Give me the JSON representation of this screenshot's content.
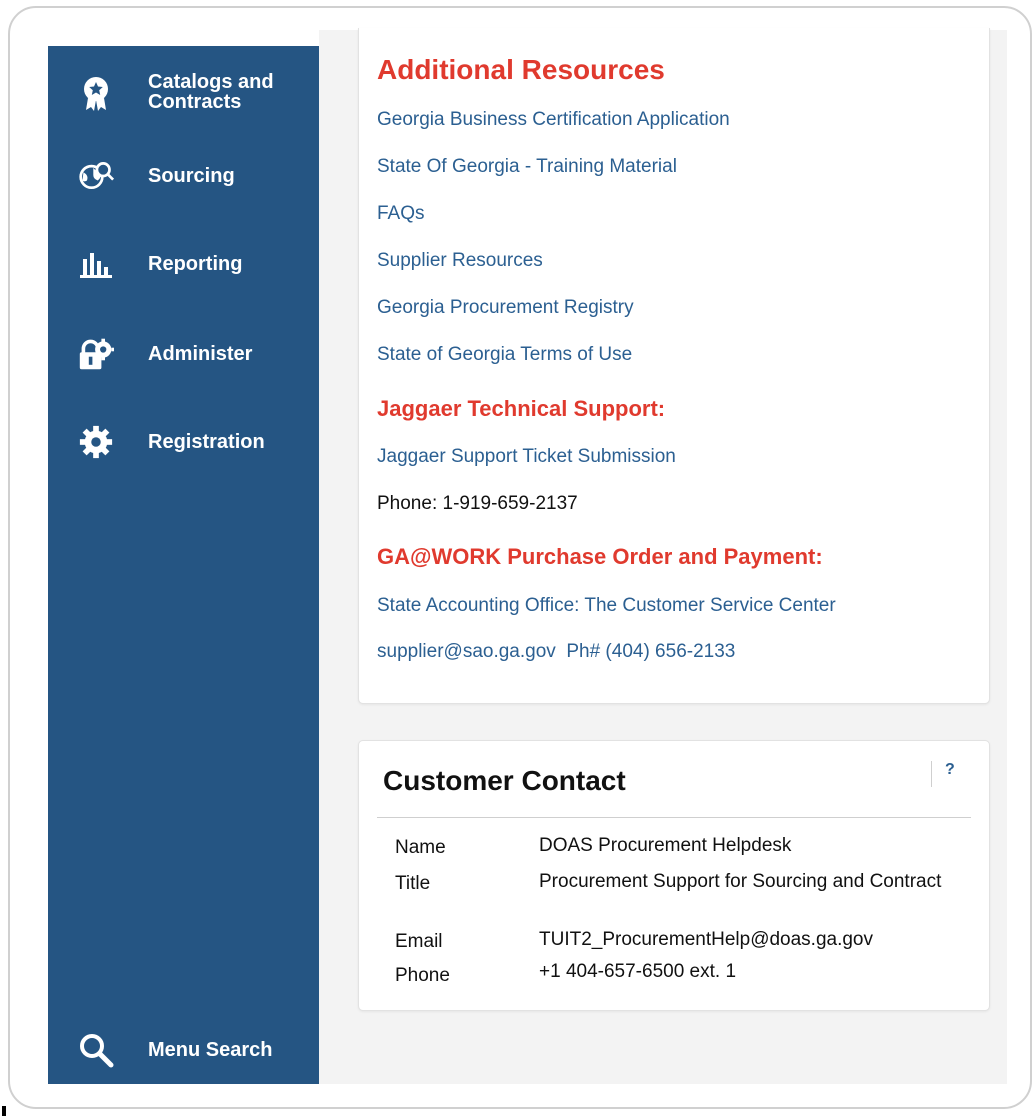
{
  "sidebar": {
    "items": [
      {
        "label": "Catalogs and Contracts",
        "icon": "award-ribbon-icon"
      },
      {
        "label": "Sourcing",
        "icon": "globe-search-icon"
      },
      {
        "label": "Reporting",
        "icon": "bar-chart-icon"
      },
      {
        "label": "Administer",
        "icon": "lock-gear-icon"
      },
      {
        "label": "Registration",
        "icon": "gear-icon"
      }
    ],
    "search_label": "Menu Search",
    "background": "#255583"
  },
  "resources": {
    "heading": "Additional Resources",
    "links": [
      "Georgia Business Certification Application",
      "State Of Georgia - Training Material",
      "FAQs",
      "Supplier Resources",
      "Georgia Procurement Registry",
      "State of Georgia Terms of Use"
    ],
    "support_heading": "Jaggaer Technical Support:",
    "support_link": "Jaggaer Support Ticket Submission",
    "support_phone": "Phone: 1-919-659-2137",
    "payment_heading": "GA@WORK Purchase Order and Payment:",
    "payment_link": "State Accounting Office: The Customer Service Center",
    "payment_contact": "supplier@sao.ga.gov  Ph# (404) 656-2133",
    "heading_color": "#e03a2e",
    "link_color": "#2b5f91"
  },
  "contact": {
    "title": "Customer Contact",
    "help": "?",
    "rows": [
      {
        "label": "Name",
        "value": "DOAS Procurement Helpdesk"
      },
      {
        "label": "Title",
        "value": "Procurement Support for Sourcing and Contract"
      },
      {
        "label": "Email",
        "value": "TUIT2_ProcurementHelp@doas.ga.gov"
      },
      {
        "label": "Phone",
        "value": "+1 404-657-6500 ext. 1"
      }
    ]
  }
}
